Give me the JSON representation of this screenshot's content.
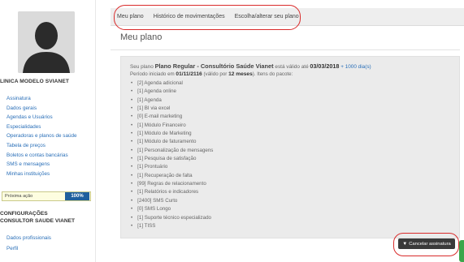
{
  "sidebar": {
    "clinic_name": "LINICA MODELO SVIANET",
    "menu": [
      "Assinatura",
      "Dados gerais",
      "Agendas e Usuários",
      "Especialidades",
      "Operadoras e planos de saúde",
      "Tabela de preços",
      "Boletos e contas bancárias",
      "SMS e mensagens",
      "Minhas instituições"
    ],
    "next_action": {
      "label": "Próxima ação",
      "percent": "100%"
    },
    "config_title_1": "CONFIGURAÇÕES",
    "config_title_2": "CONSULTOR SAUDE VIANET",
    "config_menu": [
      "Dados profissionais",
      "Perfil"
    ]
  },
  "tabs": [
    "Meu plano",
    "Histórico de movimentações",
    "Escolha/alterar seu plano"
  ],
  "main": {
    "title": "Meu plano",
    "plan": {
      "prefix": "Seu plano",
      "name": "Plano Regular - Consultório Saúde Vianet",
      "valid_prefix": "está válido até",
      "valid_date": "03/03/2018",
      "days": "+ 1000 dia(s)"
    },
    "period": {
      "prefix": "Período iniciado em",
      "start": "01/11/2116",
      "valid_prefix": "(válido por",
      "duration": "12 meses",
      "suffix": "). Itens do pacote:"
    },
    "items": [
      "[2] Agenda adicional",
      "[1] Agenda online",
      "[1] Agenda",
      "[1] BI via excel",
      "[0] E-mail marketing",
      "[1] Módulo Financeiro",
      "[1] Módulo de Marketing",
      "[1] Módulo de faturamento",
      "[1] Personalização de mensagens",
      "[1] Pesquisa de satisfação",
      "[1] Prontuário",
      "[1] Recuperação de falta",
      "[99] Regras de relacionamento",
      "[1] Relatórios e indicadores",
      "[2400] SMS Curto",
      "[0] SMS Longo",
      "[1] Suporte técnico especializado",
      "[1] TISS"
    ],
    "cancel_button": "Cancelar assinatura"
  },
  "colors": {
    "link": "#2a6fb8",
    "highlight": "#d92b2b",
    "progress": "#1f5f9e",
    "button": "#3a3a3a"
  }
}
